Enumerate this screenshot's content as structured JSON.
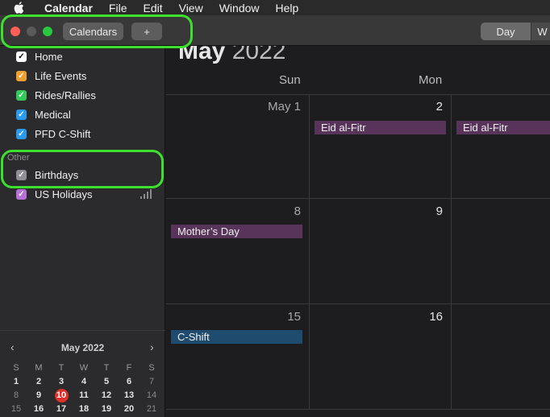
{
  "menubar": {
    "app": "Calendar",
    "items": [
      "File",
      "Edit",
      "View",
      "Window",
      "Help"
    ]
  },
  "toolbar": {
    "calendars_label": "Calendars",
    "add_label": "+",
    "view_day": "Day",
    "view_week_partial": "W"
  },
  "sidebar": {
    "calendars": [
      {
        "label": "Home",
        "color": "#ffffff",
        "checked": true
      },
      {
        "label": "Life Events",
        "color": "#f0a030",
        "checked": true
      },
      {
        "label": "Rides/Rallies",
        "color": "#34c759",
        "checked": true
      },
      {
        "label": "Medical",
        "color": "#2a9bea",
        "checked": true
      },
      {
        "label": "PFD C-Shift",
        "color": "#2a9bea",
        "checked": true
      }
    ],
    "other_label": "Other",
    "other": [
      {
        "label": "Birthdays",
        "color": "#8e8e93",
        "checked": true
      },
      {
        "label": "US Holidays",
        "color": "#b86fd6",
        "checked": true
      }
    ]
  },
  "mini_calendar": {
    "title": "May 2022",
    "prev": "‹",
    "next": "›",
    "dow": [
      "S",
      "M",
      "T",
      "W",
      "T",
      "F",
      "S"
    ],
    "weeks": [
      [
        "1",
        "2",
        "3",
        "4",
        "5",
        "6",
        "7"
      ],
      [
        "8",
        "9",
        "10",
        "11",
        "12",
        "13",
        "14"
      ],
      [
        "15",
        "16",
        "17",
        "18",
        "19",
        "20",
        "21"
      ]
    ],
    "today": "10"
  },
  "main": {
    "month": "May",
    "year": "2022",
    "dow_headers": [
      "Sun",
      "Mon"
    ],
    "weeks": [
      {
        "days": [
          {
            "num": "May 1",
            "events": []
          },
          {
            "num": "2",
            "events": [
              {
                "title": "Eid al-Fitr",
                "color": "purple"
              }
            ]
          },
          {
            "num": "",
            "events": [
              {
                "title": "Eid al-Fitr",
                "color": "purple"
              }
            ]
          }
        ]
      },
      {
        "days": [
          {
            "num": "8",
            "events": [
              {
                "title": "Mother’s Day",
                "color": "purple"
              }
            ]
          },
          {
            "num": "9",
            "events": []
          },
          {
            "num": "",
            "events": []
          }
        ]
      },
      {
        "days": [
          {
            "num": "15",
            "events": [
              {
                "title": "C-Shift",
                "color": "blue"
              }
            ]
          },
          {
            "num": "16",
            "events": []
          },
          {
            "num": "",
            "events": []
          }
        ]
      }
    ]
  }
}
